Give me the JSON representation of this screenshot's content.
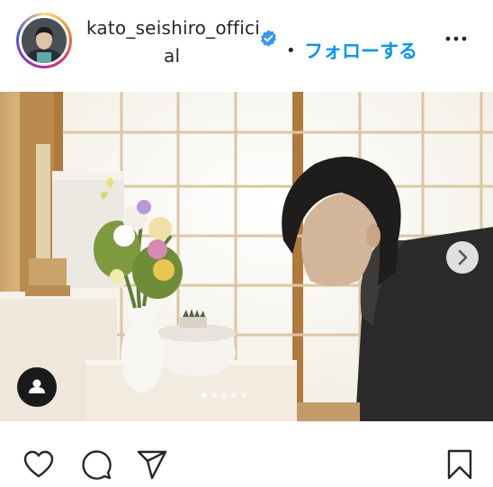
{
  "post": {
    "username_line1": "kato_seishiro_offici",
    "username_line2": "al",
    "separator": "•",
    "follow_label": "フォローする",
    "verified": true
  },
  "carousel": {
    "current_index": 1,
    "total_slides": 5
  },
  "icons": {
    "header": [
      "avatar",
      "verified-badge-icon",
      "more-options-icon"
    ],
    "overlay": [
      "next-arrow-icon",
      "user-tag-icon"
    ],
    "actions": [
      "heart-icon",
      "comment-icon",
      "share-icon",
      "bookmark-icon"
    ]
  },
  "colors": {
    "accent": "#0095f6",
    "text": "#262626",
    "verified": "#3897f0"
  }
}
